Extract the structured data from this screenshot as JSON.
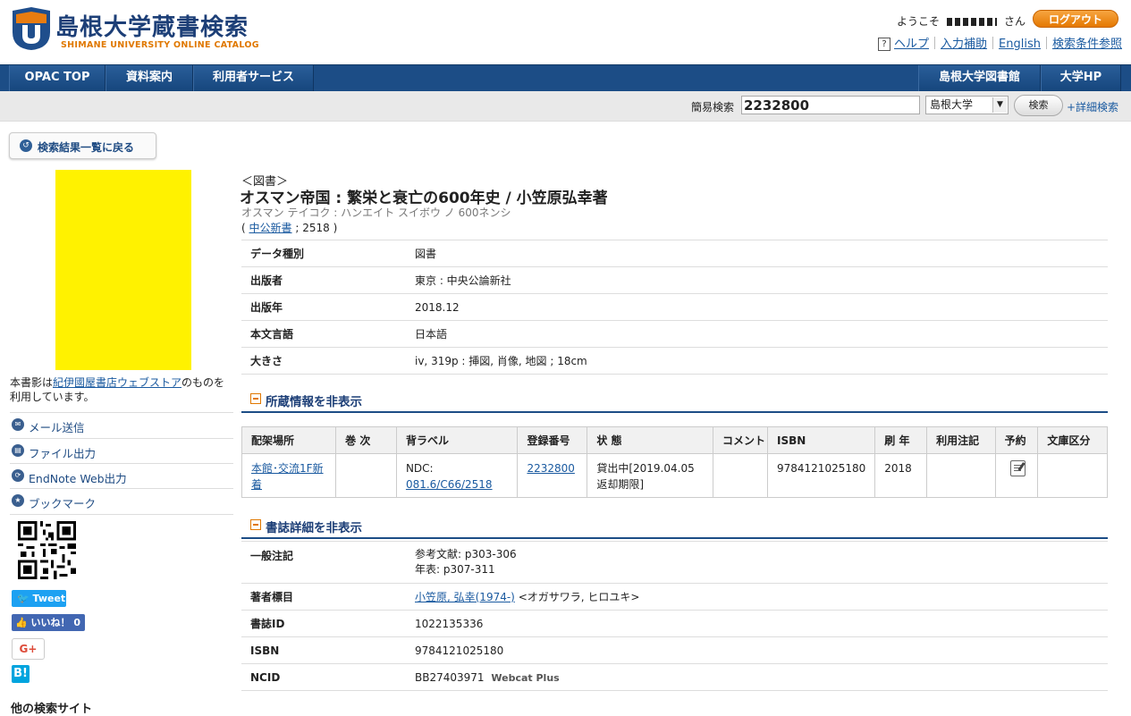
{
  "header": {
    "logo_title": "島根大学蔵書検索",
    "logo_subtitle": "SHIMANE UNIVERSITY ONLINE CATALOG",
    "welcome": "ようこそ",
    "san": "さん",
    "logout": "ログアウト",
    "links": {
      "help": "ヘルプ",
      "input_assist": "入力補助",
      "english": "English",
      "search_help": "検索条件参照"
    }
  },
  "nav": {
    "items": [
      "OPAC TOP",
      "資料案内",
      "利用者サービス"
    ],
    "right_items": [
      "島根大学図書館",
      "大学HP"
    ]
  },
  "search": {
    "label": "簡易検索",
    "value": "2232800",
    "scope": "島根大学",
    "button": "検索",
    "advanced": "+詳細検索"
  },
  "sidebar": {
    "back": "検索結果一覧に戻る",
    "cover_note_prefix": "本書影は",
    "cover_note_link": "紀伊國屋書店ウェブストア",
    "cover_note_suffix": "のものを利用しています。",
    "actions": [
      "メール送信",
      "ファイル出力",
      "EndNote Web出力",
      "ブックマーク"
    ],
    "tweet": "Tweet",
    "like": "いいね！ 0",
    "gplus": "G+",
    "hatena": "B!",
    "other_search": "他の検索サイト"
  },
  "record": {
    "doc_type": "＜図書＞",
    "title": "オスマン帝国 : 繁栄と衰亡の600年史 / 小笠原弘幸著",
    "kana": "オスマン テイコク : ハンエイト スイボウ ノ 600ネンシ",
    "series_open": "(",
    "series_link": "中公新書",
    "series_rest": "; 2518 )",
    "fields": [
      {
        "label": "データ種別",
        "value": "図書"
      },
      {
        "label": "出版者",
        "value": "東京 : 中央公論新社"
      },
      {
        "label": "出版年",
        "value": "2018.12"
      },
      {
        "label": "本文言語",
        "value": "日本語"
      },
      {
        "label": "大きさ",
        "value": "iv, 319p : 挿図, 肖像, 地図 ; 18cm"
      }
    ]
  },
  "holdings": {
    "toggle": "所蔵情報を非表示",
    "headers": [
      "配架場所",
      "巻 次",
      "背ラベル",
      "登録番号",
      "状 態",
      "コメント",
      "ISBN",
      "刷 年",
      "利用注記",
      "予約",
      "文庫区分"
    ],
    "row": {
      "location": "本館･交流1F新着",
      "volume": "",
      "label_prefix": "NDC:",
      "label_link": "081.6/C66/2518",
      "reg_no": "2232800",
      "status": "貸出中[2019.04.05返却期限]",
      "comment": "",
      "isbn": "9784121025180",
      "year": "2018",
      "note": "",
      "bunko": ""
    }
  },
  "details": {
    "toggle": "書誌詳細を非表示",
    "general_note_label": "一般注記",
    "general_note_1": "参考文献: p303-306",
    "general_note_2": "年表: p307-311",
    "author_label": "著者標目",
    "author_link": "小笠原, 弘幸(1974-)",
    "author_kana": "<オガサワラ, ヒロユキ>",
    "bib_id_label": "書誌ID",
    "bib_id": "1022135336",
    "isbn_label": "ISBN",
    "isbn": "9784121025180",
    "ncid_label": "NCID",
    "ncid": "BB27403971",
    "webcat": "Webcat Plus"
  },
  "colors": {
    "nav": "#1c4d86",
    "accent": "#e07800",
    "cover": "#fff200"
  }
}
